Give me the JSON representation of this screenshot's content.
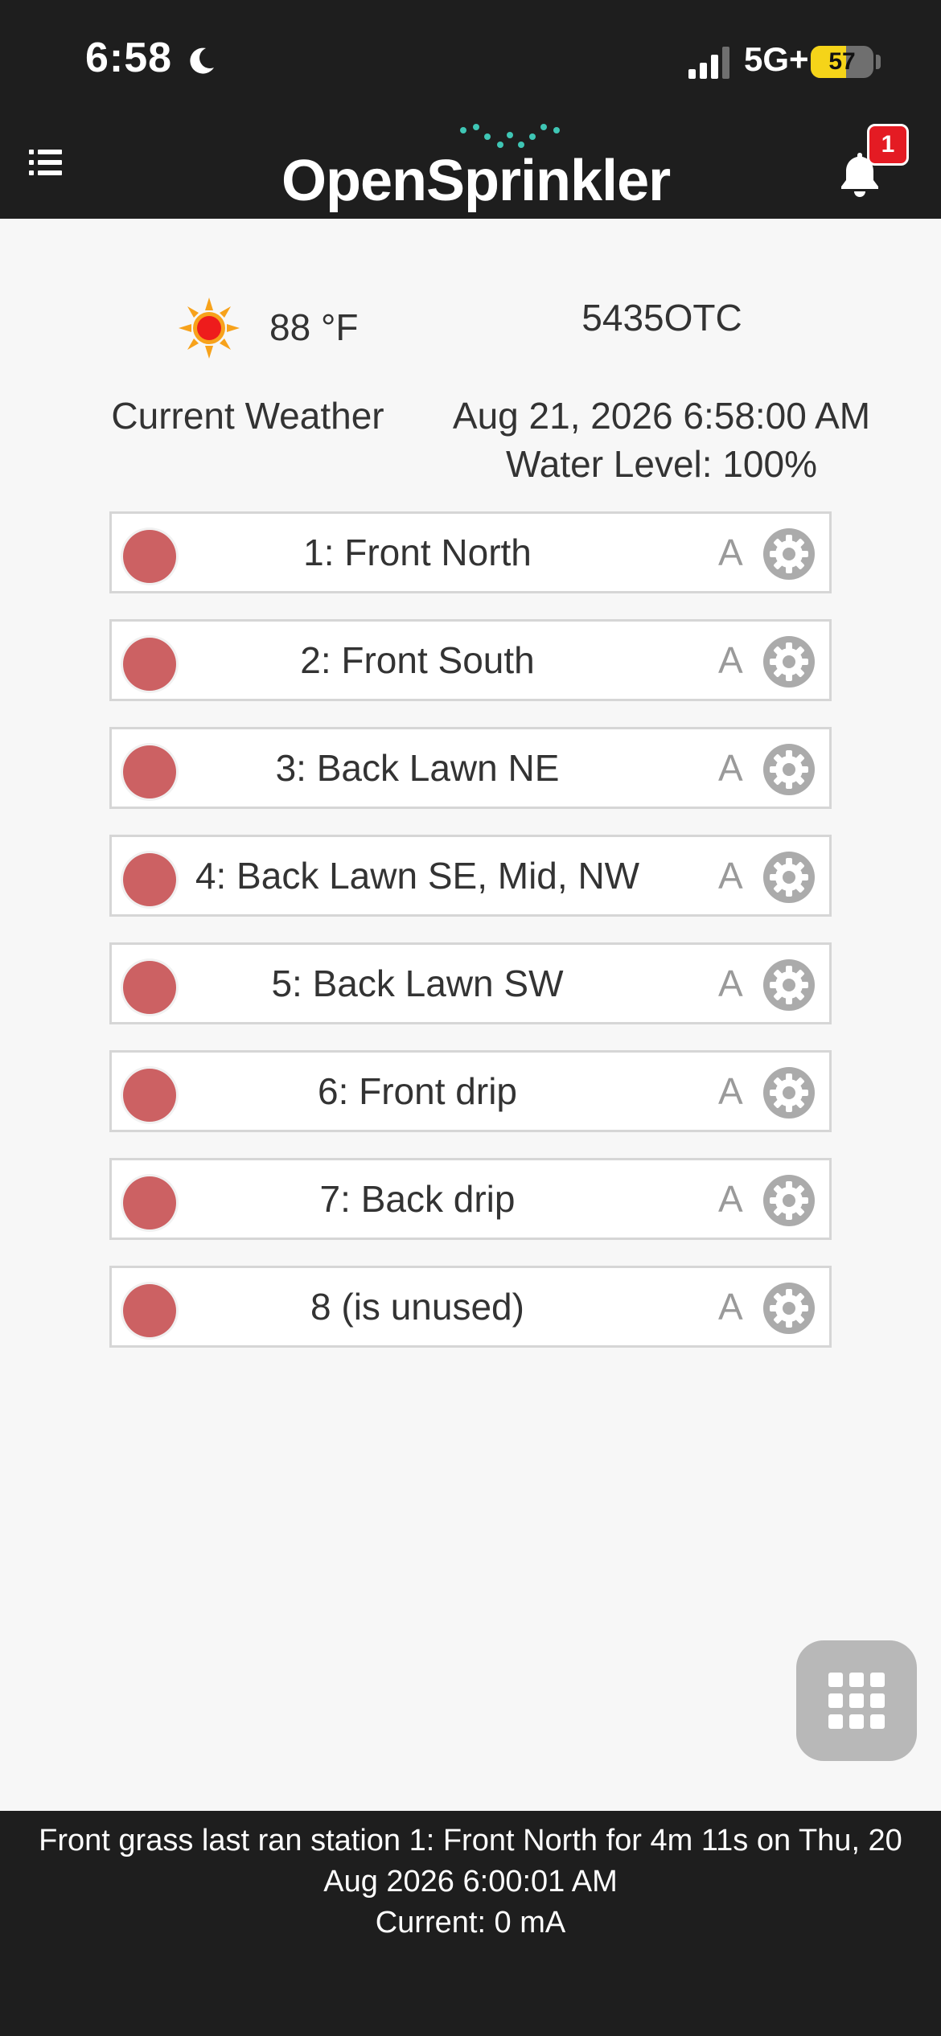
{
  "status_bar": {
    "time": "6:58",
    "network": "5G+",
    "battery": "57",
    "battery_level": 0.57
  },
  "header": {
    "logo_text": "OpenSprinkler",
    "notification_count": "1"
  },
  "info": {
    "temperature": "88 °F",
    "device_name": "5435OTC",
    "weather_label": "Current Weather",
    "datetime": "Aug 21, 2026 6:58:00 AM",
    "water_level": "Water Level: 100%"
  },
  "stations": [
    {
      "name": "1: Front North",
      "mode": "A"
    },
    {
      "name": "2: Front South",
      "mode": "A"
    },
    {
      "name": "3: Back Lawn NE",
      "mode": "A"
    },
    {
      "name": "4: Back Lawn SE, Mid, NW",
      "mode": "A"
    },
    {
      "name": "5: Back Lawn SW",
      "mode": "A"
    },
    {
      "name": "6: Front drip",
      "mode": "A"
    },
    {
      "name": "7: Back drip",
      "mode": "A"
    },
    {
      "name": "8 (is unused)",
      "mode": "A"
    }
  ],
  "colors": {
    "station_off": "#cc6163",
    "bar_background": "#1e1e1e",
    "badge": "#e41b23",
    "logo_accent": "#3fc6b5"
  },
  "icons": {
    "menu": "list-icon",
    "notifications": "bell-icon",
    "weather": "sun-icon",
    "station_settings": "gear-icon",
    "fab": "grid-icon"
  },
  "footer": {
    "last_run": "Front grass last ran station 1: Front North for 4m 11s on Thu, 20 Aug 2026 6:00:01 AM",
    "current": "Current: 0 mA"
  }
}
